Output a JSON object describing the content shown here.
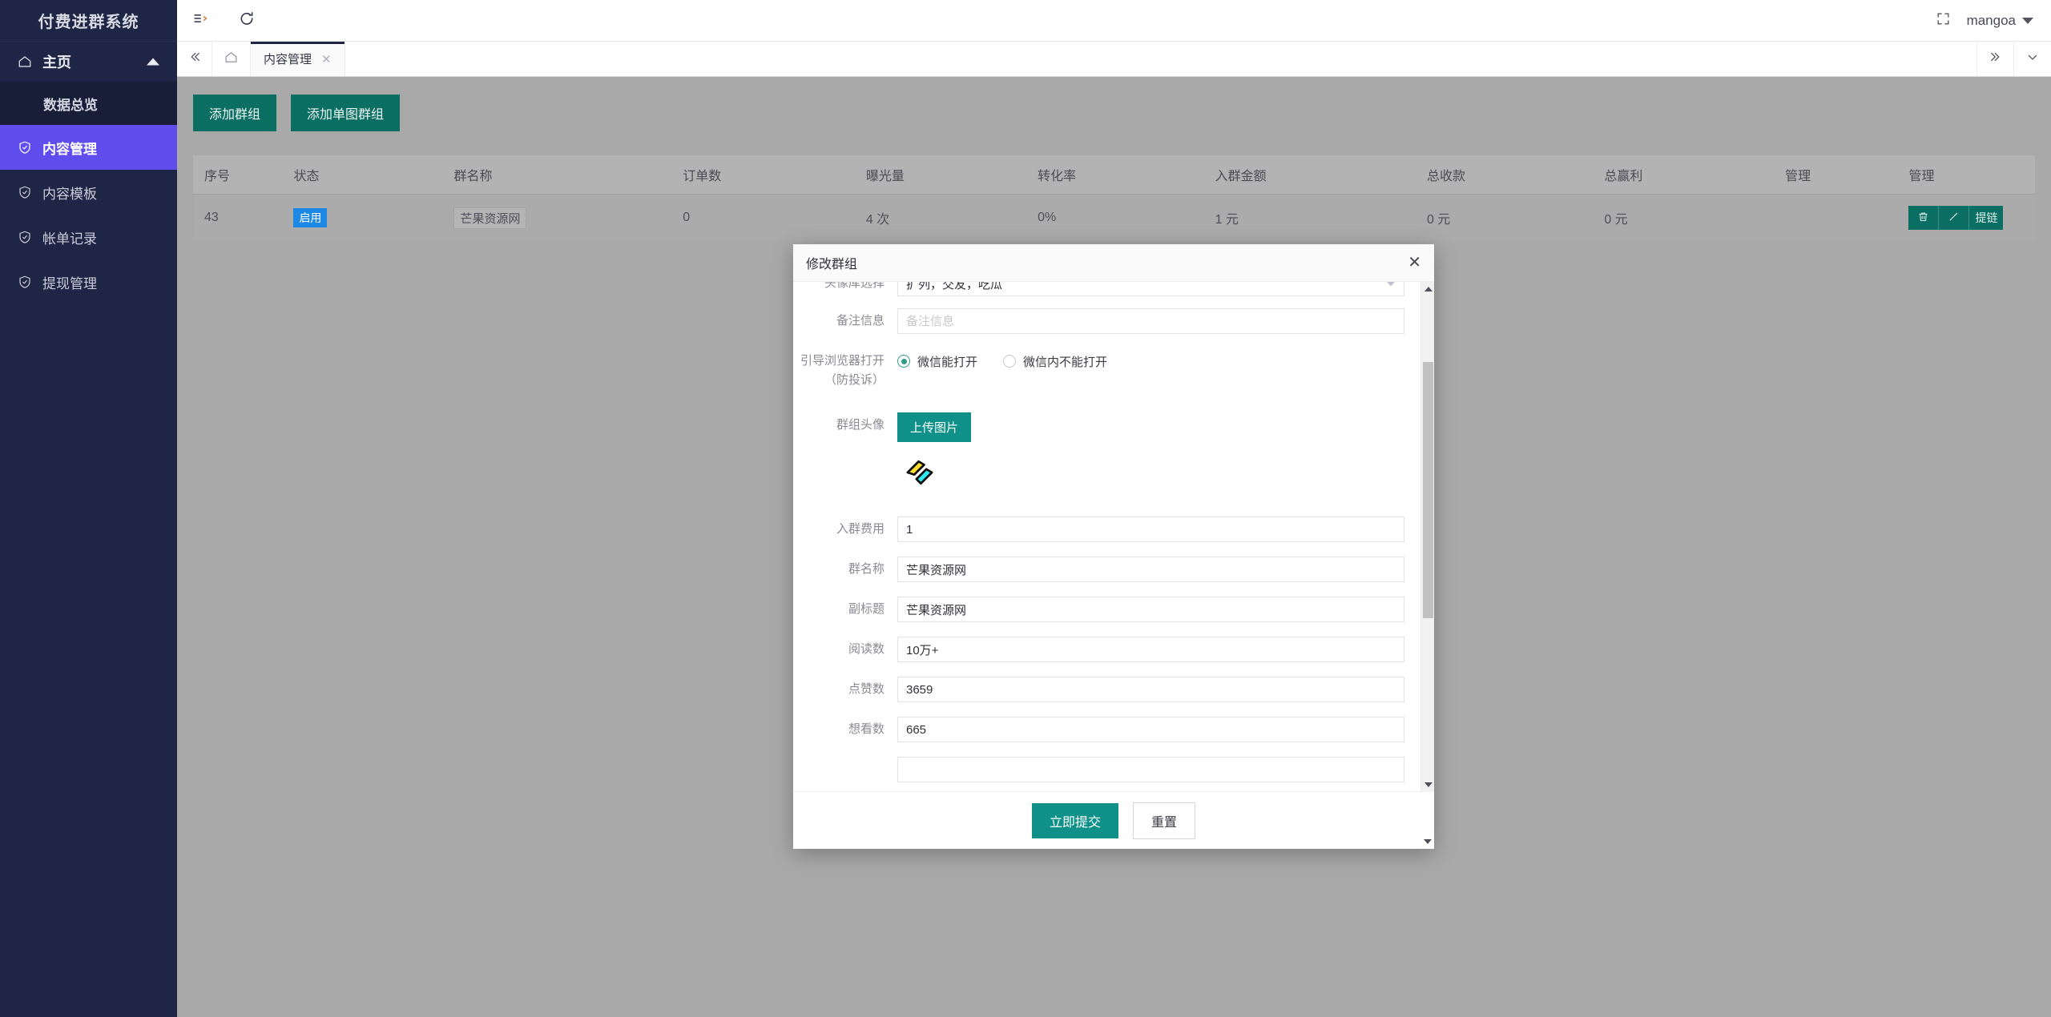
{
  "sidebar": {
    "logo": "付费进群系统",
    "group": {
      "label": "主页",
      "icon": "home-icon"
    },
    "sub_item": {
      "label": "数据总览"
    },
    "items": [
      {
        "label": "内容管理",
        "icon": "shield-check-icon",
        "active": true
      },
      {
        "label": "内容模板",
        "icon": "shield-check-icon",
        "active": false
      },
      {
        "label": "帐单记录",
        "icon": "shield-check-icon",
        "active": false
      },
      {
        "label": "提现管理",
        "icon": "shield-check-icon",
        "active": false
      }
    ]
  },
  "topbar": {
    "menu_icon": "list-indent-icon",
    "refresh_icon": "refresh-icon",
    "fullscreen_icon": "fullscreen-icon",
    "user": "mangoa"
  },
  "tabbar": {
    "collapse_icon": "double-chevron-left-icon",
    "home_icon": "home-outline-icon",
    "tabs": [
      {
        "label": "内容管理",
        "active": true,
        "closable": true
      }
    ],
    "right_more_icon": "double-chevron-right-icon",
    "right_down_icon": "chevron-down-icon"
  },
  "toolbar": {
    "add_group": "添加群组",
    "add_single_image_group": "添加单图群组"
  },
  "table": {
    "columns": [
      "序号",
      "状态",
      "群名称",
      "订单数",
      "曝光量",
      "转化率",
      "入群金额",
      "总收款",
      "总赢利",
      "管理",
      "管理"
    ],
    "rows": [
      {
        "id": "43",
        "status": "启用",
        "group_name": "芒果资源网",
        "orders": "0",
        "exposure": "4 次",
        "conversion": "0%",
        "join_amount": "1 元",
        "total_received": "0 元",
        "total_profit": "0 元",
        "manage_blank": "",
        "actions": [
          {
            "label": "",
            "icon": "trash-icon",
            "name": "delete-button"
          },
          {
            "label": "",
            "icon": "pencil-icon",
            "name": "edit-button"
          },
          {
            "label": "提链",
            "icon": "",
            "name": "extract-link-button"
          }
        ]
      }
    ]
  },
  "modal": {
    "title": "修改群组",
    "close_icon": "close-icon",
    "fields": {
      "avatar_library": {
        "label": "头像库选择",
        "value": "扩列，交友，吃瓜"
      },
      "remark": {
        "label": "备注信息",
        "value": "",
        "placeholder": "备注信息"
      },
      "browser_guide": {
        "label": "引导浏览器打开（防投诉）",
        "options": [
          {
            "label": "微信能打开",
            "selected": true
          },
          {
            "label": "微信内不能打开",
            "selected": false
          }
        ]
      },
      "group_avatar": {
        "label": "群组头像",
        "upload_label": "上传图片",
        "image_alt": "lightning-bolt-logo"
      },
      "join_fee": {
        "label": "入群费用",
        "value": "1"
      },
      "group_name": {
        "label": "群名称",
        "value": "芒果资源网"
      },
      "subtitle": {
        "label": "副标题",
        "value": "芒果资源网"
      },
      "read_count": {
        "label": "阅读数",
        "value": "10万+"
      },
      "like_count": {
        "label": "点赞数",
        "value": "3659"
      },
      "want_count": {
        "label": "想看数",
        "value": "665"
      }
    },
    "footer": {
      "submit": "立即提交",
      "reset": "重置"
    }
  },
  "colors": {
    "sidebar_bg": "#1f2544",
    "sidebar_active": "#5f4dee",
    "teal": "#0b6e63",
    "teal_bright": "#0f9189",
    "badge_blue": "#1e88e5",
    "content_bg": "#a9a9a9"
  }
}
